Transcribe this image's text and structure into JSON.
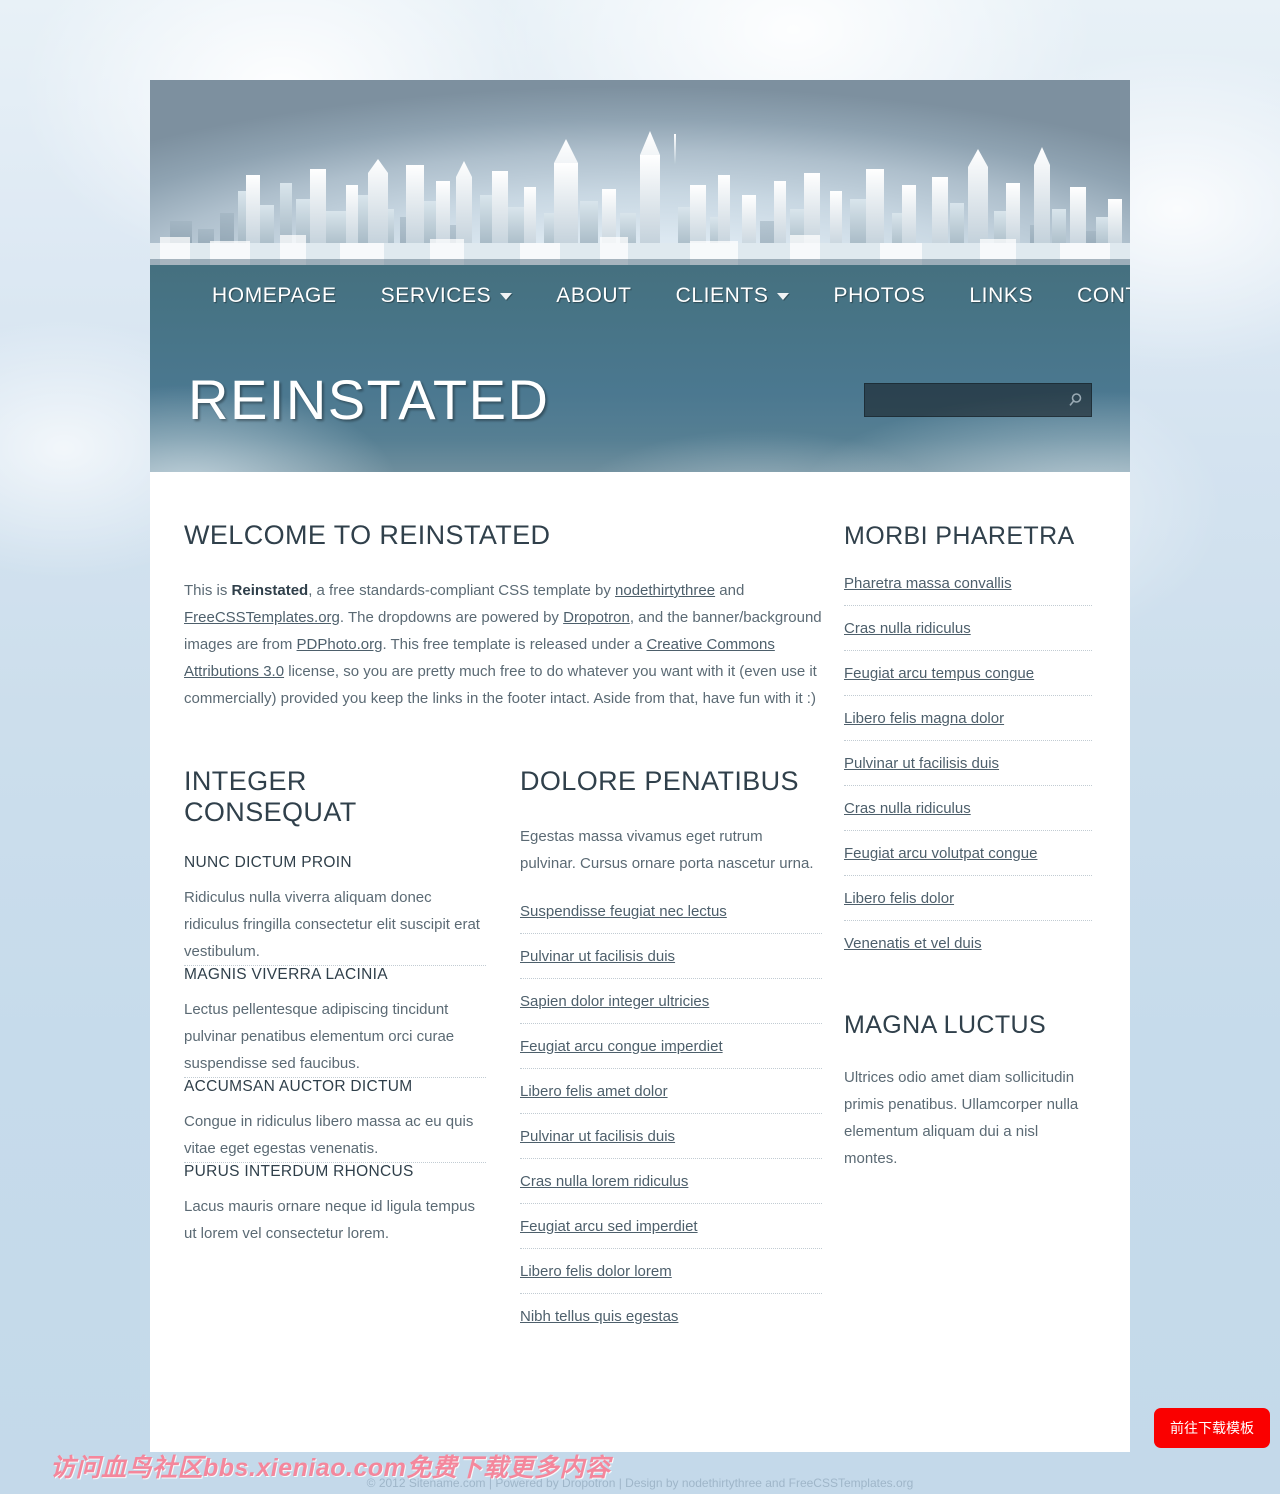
{
  "site": {
    "title": "REINSTATED"
  },
  "nav": {
    "items": [
      {
        "label": "HOMEPAGE",
        "has_dropdown": false
      },
      {
        "label": "SERVICES",
        "has_dropdown": true
      },
      {
        "label": "ABOUT",
        "has_dropdown": false
      },
      {
        "label": "CLIENTS",
        "has_dropdown": true
      },
      {
        "label": "PHOTOS",
        "has_dropdown": false
      },
      {
        "label": "LINKS",
        "has_dropdown": false
      },
      {
        "label": "CONTACT",
        "has_dropdown": false
      }
    ]
  },
  "search": {
    "value": "",
    "placeholder": "",
    "icon": "search-icon"
  },
  "main": {
    "welcome": {
      "title": "WELCOME TO REINSTATED",
      "paragraph": {
        "part1": "This is ",
        "bold1": "Reinstated",
        "part2": ", a free standards-compliant CSS template by ",
        "link1": "nodethirtythree",
        "part3": " and ",
        "link2": "FreeCSSTemplates.org",
        "part4": ". The dropdowns are powered by ",
        "link3": "Dropotron",
        "part5": ", and the banner/background images are from ",
        "link4": "PDPhoto.org",
        "part6": ". This free template is released under a ",
        "link5": "Creative Commons Attributions 3.0",
        "part7": " license, so you are pretty much free to do whatever you want with it (even use it commercially) provided you keep the links in the footer intact. Aside from that, have fun with it :)"
      }
    },
    "integer_consequat": {
      "title": "INTEGER CONSEQUAT",
      "items": [
        {
          "heading": "NUNC DICTUM PROIN",
          "text": "Ridiculus nulla viverra aliquam donec ridiculus fringilla consectetur elit suscipit erat vestibulum."
        },
        {
          "heading": "MAGNIS VIVERRA LACINIA",
          "text": "Lectus pellentesque adipiscing tincidunt pulvinar penatibus elementum orci curae suspendisse sed faucibus."
        },
        {
          "heading": "ACCUMSAN AUCTOR DICTUM",
          "text": "Congue in ridiculus libero massa ac eu quis vitae eget egestas venenatis."
        },
        {
          "heading": "PURUS INTERDUM RHONCUS",
          "text": "Lacus mauris ornare neque id ligula tempus ut lorem vel consectetur lorem."
        }
      ]
    },
    "dolore_penatibus": {
      "title": "DOLORE PENATIBUS",
      "intro": "Egestas massa vivamus eget rutrum pulvinar. Cursus ornare porta nascetur urna.",
      "links": [
        "Suspendisse feugiat nec lectus",
        "Pulvinar ut facilisis duis",
        "Sapien dolor integer ultricies",
        "Feugiat arcu congue imperdiet",
        "Libero felis amet dolor",
        "Pulvinar ut facilisis duis",
        "Cras nulla lorem ridiculus",
        "Feugiat arcu sed imperdiet",
        "Libero felis dolor lorem",
        "Nibh tellus quis egestas"
      ]
    }
  },
  "sidebar": {
    "morbi_pharetra": {
      "title": "MORBI PHARETRA",
      "links": [
        "Pharetra massa convallis",
        "Cras nulla ridiculus",
        "Feugiat arcu tempus congue",
        "Libero felis magna dolor",
        "Pulvinar ut facilisis duis",
        "Cras nulla ridiculus",
        "Feugiat arcu volutpat congue",
        "Libero felis dolor",
        "Venenatis et vel duis"
      ]
    },
    "magna_luctus": {
      "title": "MAGNA LUCTUS",
      "text": "Ultrices odio amet diam sollicitudin primis penatibus. Ullamcorper nulla elementum aliquam dui a nisl montes."
    }
  },
  "footer": {
    "credit": "© 2012 Sitename.com | Powered by Dropotron | Design by nodethirtythree and FreeCSSTemplates.org"
  },
  "overlay": {
    "watermark": "访问血鸟社区bbs.xieniao.com免费下载更多内容",
    "download_button": "前往下载模板"
  },
  "colors": {
    "header_blue": "#4b7890",
    "page_background": "#c6dbeb",
    "accent_red": "#fa0000",
    "watermark_pink": "#f4879c",
    "heading_dark": "#30404b",
    "body_gray": "#5b6a74"
  }
}
